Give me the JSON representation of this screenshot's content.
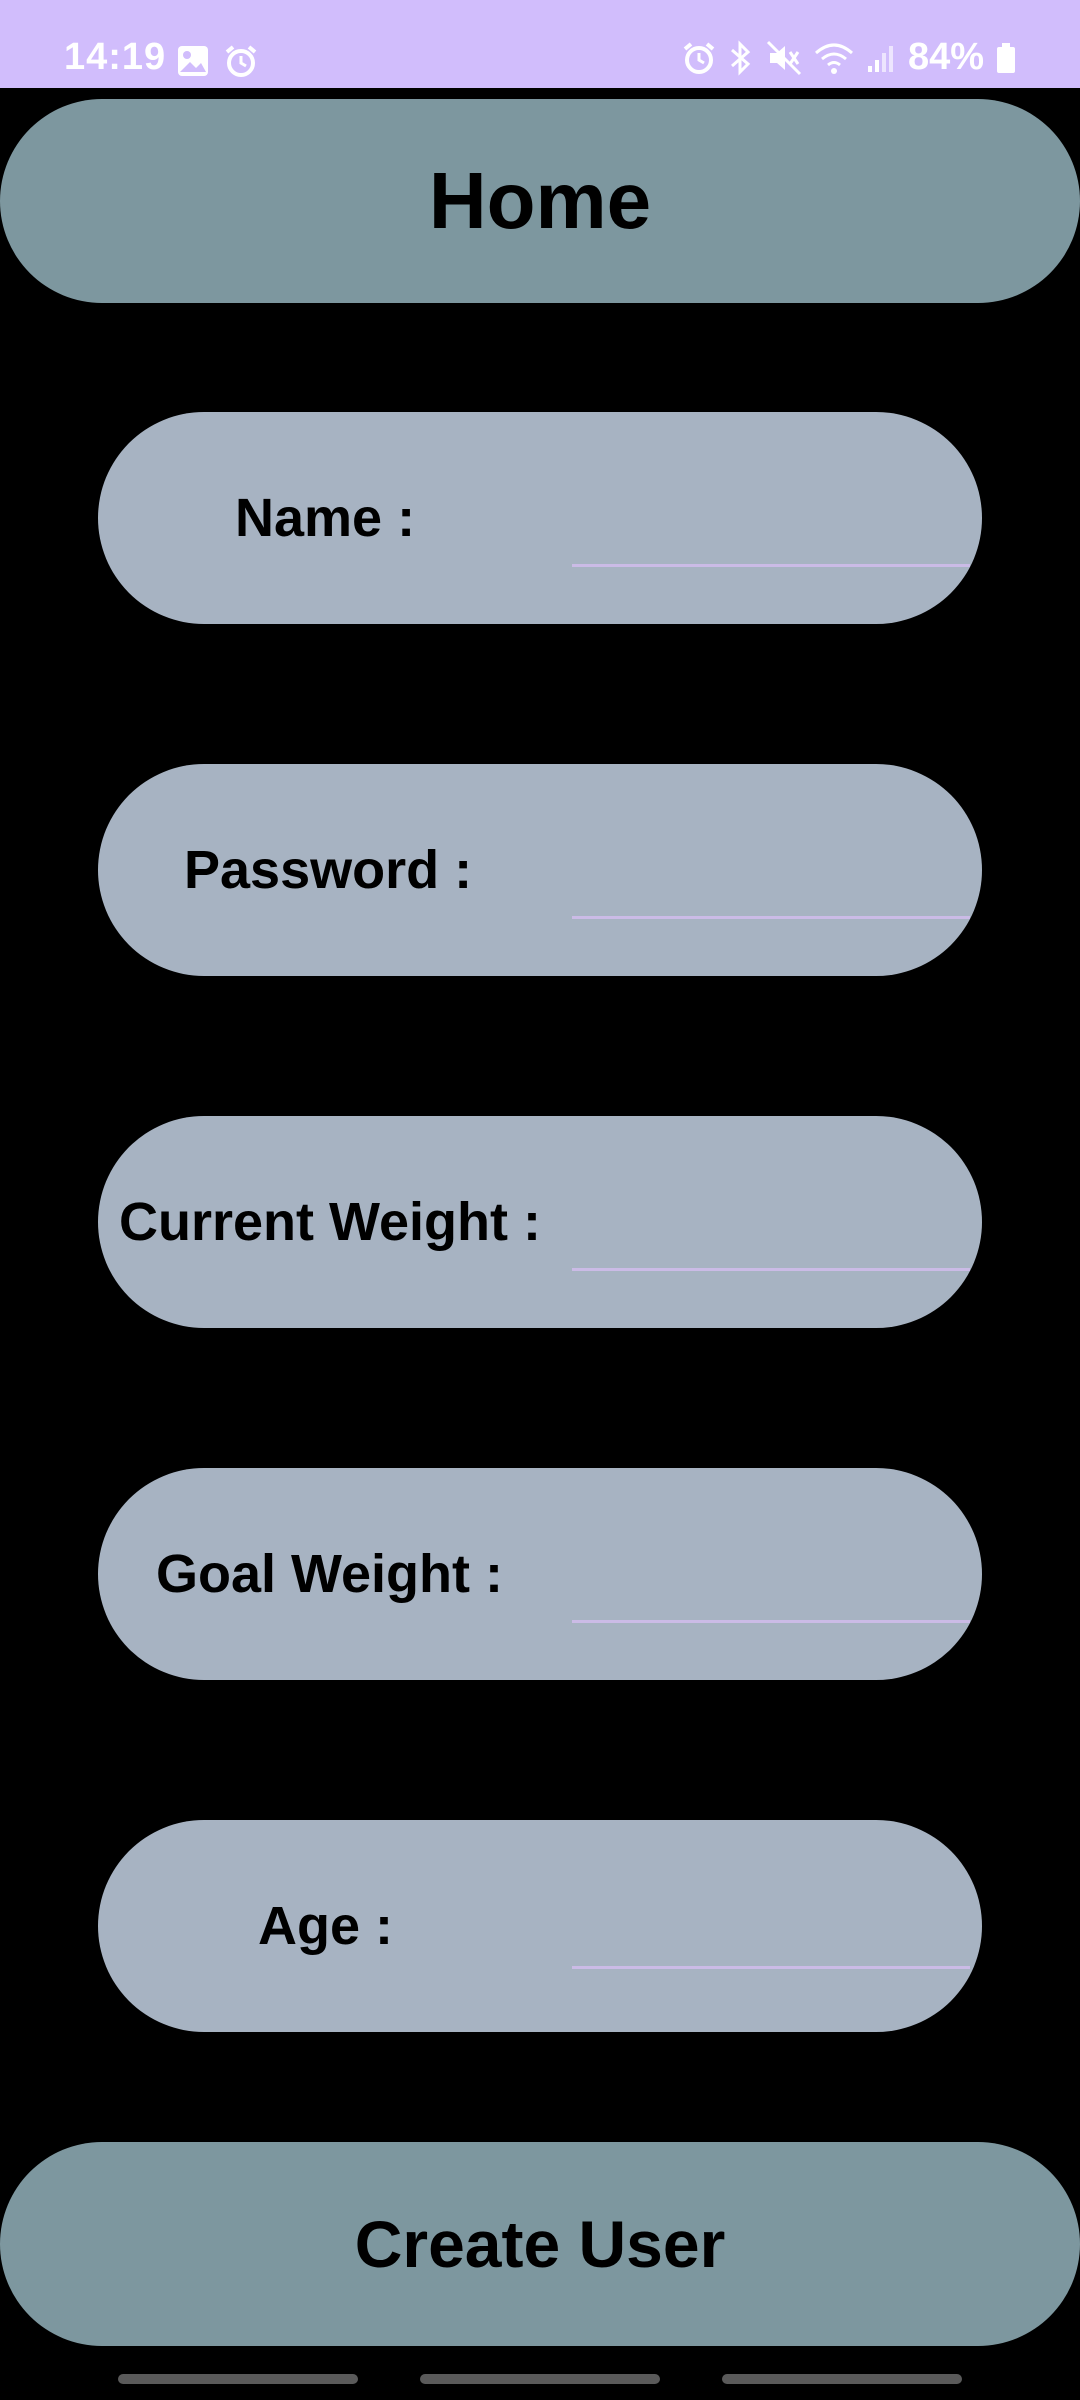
{
  "status_bar": {
    "time": "14:19",
    "battery": "84%",
    "background": "#d1bdfc",
    "left_icons": [
      "image-icon",
      "alarm-icon"
    ],
    "right_icons": [
      "alarm-icon",
      "bluetooth-icon",
      "mute-icon",
      "wifi-icon",
      "signal-icon",
      "battery-icon"
    ]
  },
  "header": {
    "title": "Home",
    "color": "#7d979f"
  },
  "form": {
    "fields": [
      {
        "label": "Name :",
        "value": "",
        "placeholder": ""
      },
      {
        "label": "Password :",
        "value": "",
        "placeholder": ""
      },
      {
        "label": "Current Weight :",
        "value": "",
        "placeholder": ""
      },
      {
        "label": "Goal Weight :",
        "value": "",
        "placeholder": ""
      },
      {
        "label": "Age :",
        "value": "",
        "placeholder": ""
      }
    ],
    "field_color": "#a7b3c2",
    "underline_color": "#cbbbe6"
  },
  "actions": {
    "create_label": "Create User"
  }
}
